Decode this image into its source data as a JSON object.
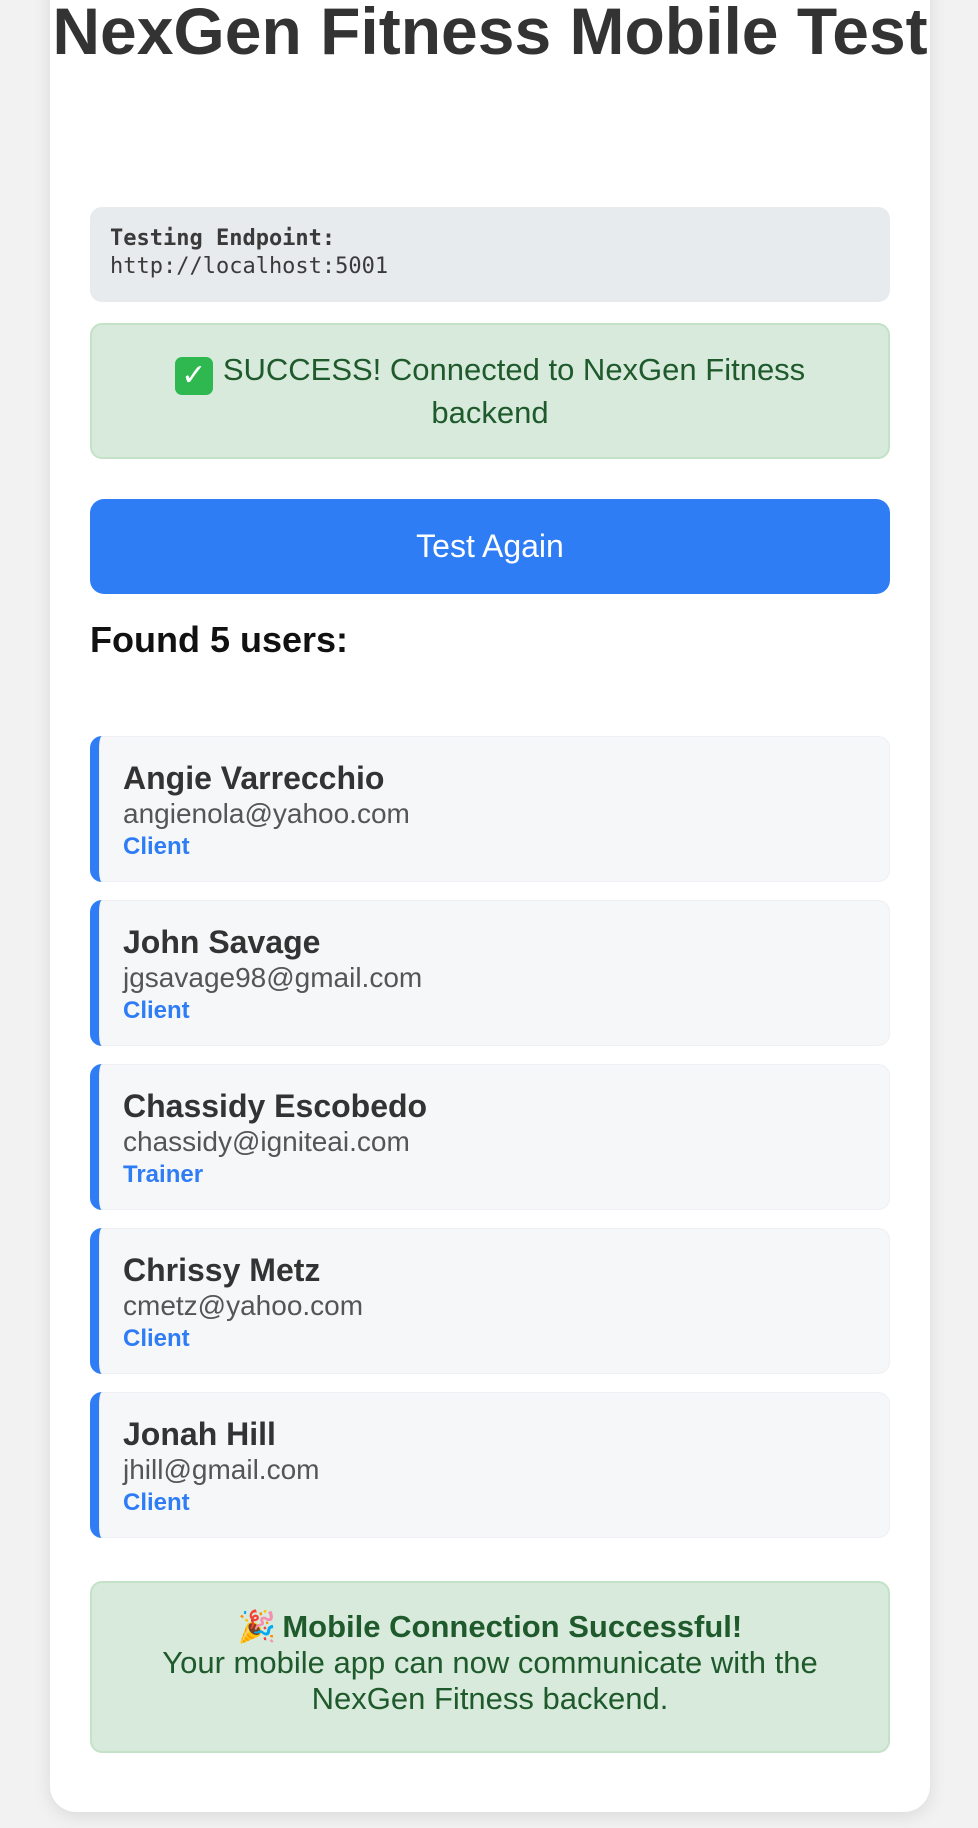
{
  "page": {
    "title": "NexGen Fitness Mobile Test"
  },
  "endpoint": {
    "label": "Testing Endpoint:",
    "url": "http://localhost:5001"
  },
  "status": {
    "icon": "check-mark-icon",
    "message": "SUCCESS! Connected to NexGen Fitness backend"
  },
  "actions": {
    "test_again_label": "Test Again"
  },
  "users": {
    "heading": "Found 5 users:",
    "items": [
      {
        "name": "Angie Varrecchio",
        "email": "angienola@yahoo.com",
        "role": "Client"
      },
      {
        "name": "John Savage",
        "email": "jgsavage98@gmail.com",
        "role": "Client"
      },
      {
        "name": "Chassidy Escobedo",
        "email": "chassidy@igniteai.com",
        "role": "Trainer"
      },
      {
        "name": "Chrissy Metz",
        "email": "cmetz@yahoo.com",
        "role": "Client"
      },
      {
        "name": "Jonah Hill",
        "email": "jhill@gmail.com",
        "role": "Client"
      }
    ]
  },
  "mobile_result": {
    "icon": "party-popper-icon",
    "headline": "Mobile Connection Successful!",
    "body": "Your mobile app can now communicate with the NexGen Fitness backend."
  },
  "colors": {
    "accent": "#2f7df5",
    "success_bg": "#d8eadb",
    "success_text": "#1f5a2c",
    "endpoint_bg": "#e8ebee"
  }
}
